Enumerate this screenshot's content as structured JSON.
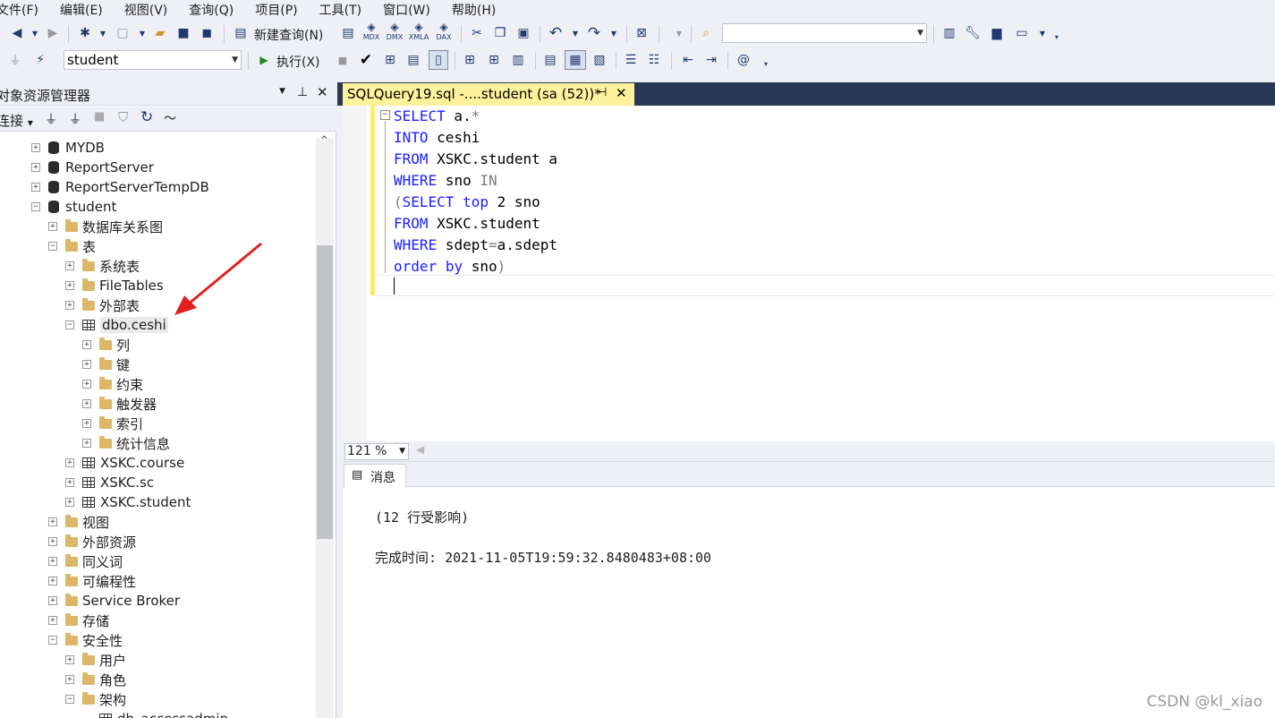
{
  "menu": [
    "文件(F)",
    "编辑(E)",
    "视图(V)",
    "查询(Q)",
    "项目(P)",
    "工具(T)",
    "窗口(W)",
    "帮助(H)"
  ],
  "toolbar": {
    "new_query_label": "新建查询(N)",
    "mdx": "MDX",
    "dmx": "DMX",
    "xmla": "XMLA",
    "dax": "DAX",
    "database_combo": "student",
    "execute_label": "执行(X)",
    "search_combo": ""
  },
  "object_explorer": {
    "title": "对象资源管理器",
    "connect_label": "连接",
    "tree": [
      {
        "label": "MYDB",
        "level": 0,
        "icon": "database-icon",
        "expander": "+"
      },
      {
        "label": "ReportServer",
        "level": 0,
        "icon": "database-icon",
        "expander": "+"
      },
      {
        "label": "ReportServerTempDB",
        "level": 0,
        "icon": "database-icon",
        "expander": "+"
      },
      {
        "label": "student",
        "level": 0,
        "icon": "database-icon",
        "expander": "-"
      },
      {
        "label": "数据库关系图",
        "level": 1,
        "icon": "folder-icon",
        "expander": "+"
      },
      {
        "label": "表",
        "level": 1,
        "icon": "folder-icon",
        "expander": "-"
      },
      {
        "label": "系统表",
        "level": 2,
        "icon": "folder-icon",
        "expander": "+"
      },
      {
        "label": "FileTables",
        "level": 2,
        "icon": "folder-icon",
        "expander": "+"
      },
      {
        "label": "外部表",
        "level": 2,
        "icon": "folder-icon",
        "expander": "+"
      },
      {
        "label": "dbo.ceshi",
        "level": 2,
        "icon": "table-icon",
        "expander": "-"
      },
      {
        "label": "列",
        "level": 3,
        "icon": "folder-icon",
        "expander": "+"
      },
      {
        "label": "键",
        "level": 3,
        "icon": "folder-icon",
        "expander": "+"
      },
      {
        "label": "约束",
        "level": 3,
        "icon": "folder-icon",
        "expander": "+"
      },
      {
        "label": "触发器",
        "level": 3,
        "icon": "folder-icon",
        "expander": "+"
      },
      {
        "label": "索引",
        "level": 3,
        "icon": "folder-icon",
        "expander": "+"
      },
      {
        "label": "统计信息",
        "level": 3,
        "icon": "folder-icon",
        "expander": "+"
      },
      {
        "label": "XSKC.course",
        "level": 2,
        "icon": "table-icon",
        "expander": "+"
      },
      {
        "label": "XSKC.sc",
        "level": 2,
        "icon": "table-icon",
        "expander": "+"
      },
      {
        "label": "XSKC.student",
        "level": 2,
        "icon": "table-icon",
        "expander": "+"
      },
      {
        "label": "视图",
        "level": 1,
        "icon": "folder-icon",
        "expander": "+"
      },
      {
        "label": "外部资源",
        "level": 1,
        "icon": "folder-icon",
        "expander": "+"
      },
      {
        "label": "同义词",
        "level": 1,
        "icon": "folder-icon",
        "expander": "+"
      },
      {
        "label": "可编程性",
        "level": 1,
        "icon": "folder-icon",
        "expander": "+"
      },
      {
        "label": "Service Broker",
        "level": 1,
        "icon": "folder-icon",
        "expander": "+"
      },
      {
        "label": "存储",
        "level": 1,
        "icon": "folder-icon",
        "expander": "+"
      },
      {
        "label": "安全性",
        "level": 1,
        "icon": "folder-icon",
        "expander": "-"
      },
      {
        "label": "用户",
        "level": 2,
        "icon": "folder-icon",
        "expander": "+"
      },
      {
        "label": "角色",
        "level": 2,
        "icon": "folder-icon",
        "expander": "+"
      },
      {
        "label": "架构",
        "level": 2,
        "icon": "folder-icon",
        "expander": "-"
      },
      {
        "label": "db_accessadmin",
        "level": 3,
        "icon": "schema-icon",
        "expander": ""
      }
    ]
  },
  "document_tab": {
    "title": "SQLQuery19.sql -....student (sa (52))*",
    "pin": "⊣",
    "close": "✕"
  },
  "editor": {
    "lines": [
      [
        {
          "t": "SELECT",
          "c": "kw"
        },
        {
          "t": " a.",
          "c": "id"
        },
        {
          "t": "*",
          "c": "gr"
        }
      ],
      [
        {
          "t": "INTO",
          "c": "kw"
        },
        {
          "t": " ceshi",
          "c": "id"
        }
      ],
      [
        {
          "t": "FROM",
          "c": "kw"
        },
        {
          "t": " XSKC.student a",
          "c": "id"
        }
      ],
      [
        {
          "t": "WHERE",
          "c": "kw"
        },
        {
          "t": " sno ",
          "c": "id"
        },
        {
          "t": "IN",
          "c": "gr"
        }
      ],
      [
        {
          "t": "(",
          "c": "gr"
        },
        {
          "t": "SELECT",
          "c": "kw"
        },
        {
          "t": " ",
          "c": "id"
        },
        {
          "t": "top",
          "c": "kw"
        },
        {
          "t": " 2 sno",
          "c": "id"
        }
      ],
      [
        {
          "t": "FROM",
          "c": "kw"
        },
        {
          "t": " XSKC.student",
          "c": "id"
        }
      ],
      [
        {
          "t": "WHERE",
          "c": "kw"
        },
        {
          "t": " sdept",
          "c": "id"
        },
        {
          "t": "=",
          "c": "gr"
        },
        {
          "t": "a.sdept",
          "c": "id"
        }
      ],
      [
        {
          "t": "order",
          "c": "kw"
        },
        {
          "t": " ",
          "c": "id"
        },
        {
          "t": "by",
          "c": "kw"
        },
        {
          "t": " sno",
          "c": "id"
        },
        {
          "t": ")",
          "c": "gr"
        }
      ]
    ]
  },
  "zoom": "121 %",
  "results": {
    "tab_label": "消息",
    "line1": "(12 行受影响)",
    "line2_label": "完成时间:",
    "line2_value": "2021-11-05T19:59:32.8480483+08:00"
  },
  "watermark": "CSDN @kl_xiao",
  "colors": {
    "keyword": "#1d20ff",
    "tab_bg": "#fff29d",
    "tabstrip": "#293955",
    "annotation_arrow": "#e02020"
  }
}
